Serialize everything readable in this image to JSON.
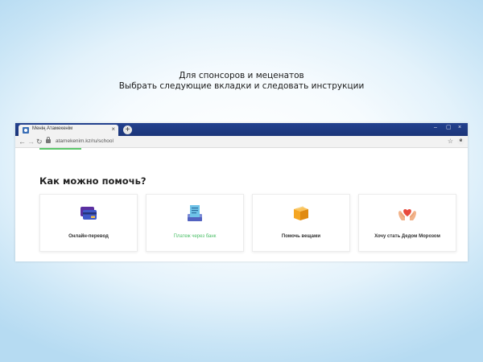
{
  "caption": {
    "line1": "Для спонсоров и меценатов",
    "line2": "Выбрать следующие вкладки и следовать инструкции"
  },
  "browser": {
    "tab_title": "Менің Атамекенім",
    "tab_close": "×",
    "new_tab": "+",
    "url": "atamekenim.kz/ru/school",
    "window_controls": [
      "‒",
      "▢",
      "×"
    ],
    "nav_icons": [
      "arrow-left-icon",
      "arrow-right-icon",
      "reload-icon",
      "lock-icon",
      "star-icon",
      "extension-icon"
    ]
  },
  "page": {
    "heading": "Как можно помочь?",
    "cards": [
      {
        "label": "Онлайн-перевод",
        "icon": "credit-cards-icon"
      },
      {
        "label": "Платеж через банк",
        "icon": "bank-receipt-icon",
        "active": true
      },
      {
        "label": "Помочь вещами",
        "icon": "box-icon"
      },
      {
        "label": "Хочу стать Дедом Морозом",
        "icon": "hands-heart-icon"
      }
    ]
  },
  "colors": {
    "titlebar": "#1f3b85",
    "accent_green": "#4fc06a",
    "card_blue": "#3f59c8",
    "box_orange": "#f5a623",
    "heart_red": "#e84a3c"
  }
}
